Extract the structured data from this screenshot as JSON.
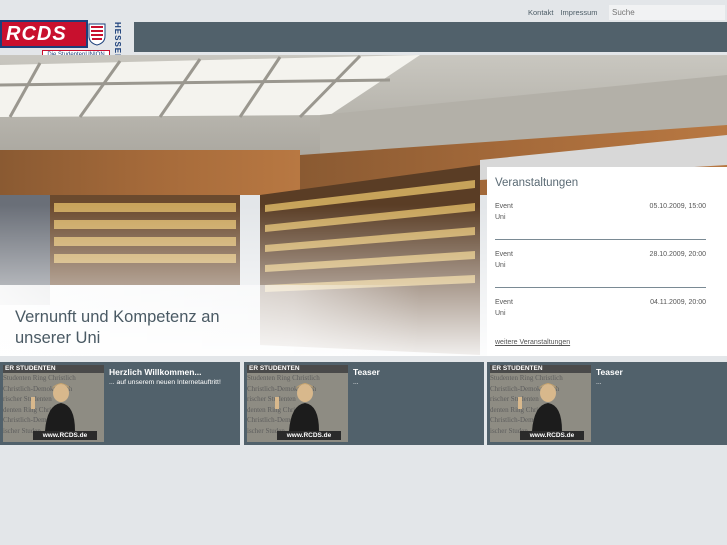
{
  "header": {
    "logo_text": "RCDS",
    "logo_tagline": "Die StudentenUNION",
    "logo_state": "HESSEN",
    "nav": [
      "Kontakt",
      "Impressum"
    ],
    "search_placeholder": "Suche"
  },
  "hero": {
    "line1": "Vernunft und Kompetenz an",
    "line2": "unserer Uni"
  },
  "events": {
    "title": "Veranstaltungen",
    "items": [
      {
        "name": "Event",
        "place": "Uni",
        "date": "05.10.2009, 15:00"
      },
      {
        "name": "Event",
        "place": "Uni",
        "date": "28.10.2009, 20:00"
      },
      {
        "name": "Event",
        "place": "Uni",
        "date": "04.11.2009, 20:00"
      }
    ],
    "more_link": "weitere Veranstaltungen"
  },
  "teasers": [
    {
      "title": "Herzlich Willkommen...",
      "text": "... auf unserem neuen Internetauftritt!",
      "banner": "ER STUDENTEN",
      "bg_lines": [
        "Studenten Ring Christlich",
        "Christlich-Demokratisch",
        "rischer Studenten",
        "denten Ring Christ",
        "Christlich-Demo",
        "ischer Studen"
      ],
      "url": "www.RCDS.de"
    },
    {
      "title": "Teaser",
      "text": "...",
      "banner": "ER STUDENTEN",
      "bg_lines": [
        "Studenten Ring Christlich",
        "Christlich-Demokratisch",
        "rischer Studenten",
        "denten Ring Christ",
        "Christlich-Demo",
        "ischer Studen"
      ],
      "url": "www.RCDS.de"
    },
    {
      "title": "Teaser",
      "text": "...",
      "banner": "ER STUDENTEN",
      "bg_lines": [
        "Studenten Ring Christlich",
        "Christlich-Demokratisch",
        "rischer Studenten",
        "denten Ring Christ",
        "Christlich-Demo",
        "ischer Studen"
      ],
      "url": "www.RCDS.de"
    }
  ]
}
